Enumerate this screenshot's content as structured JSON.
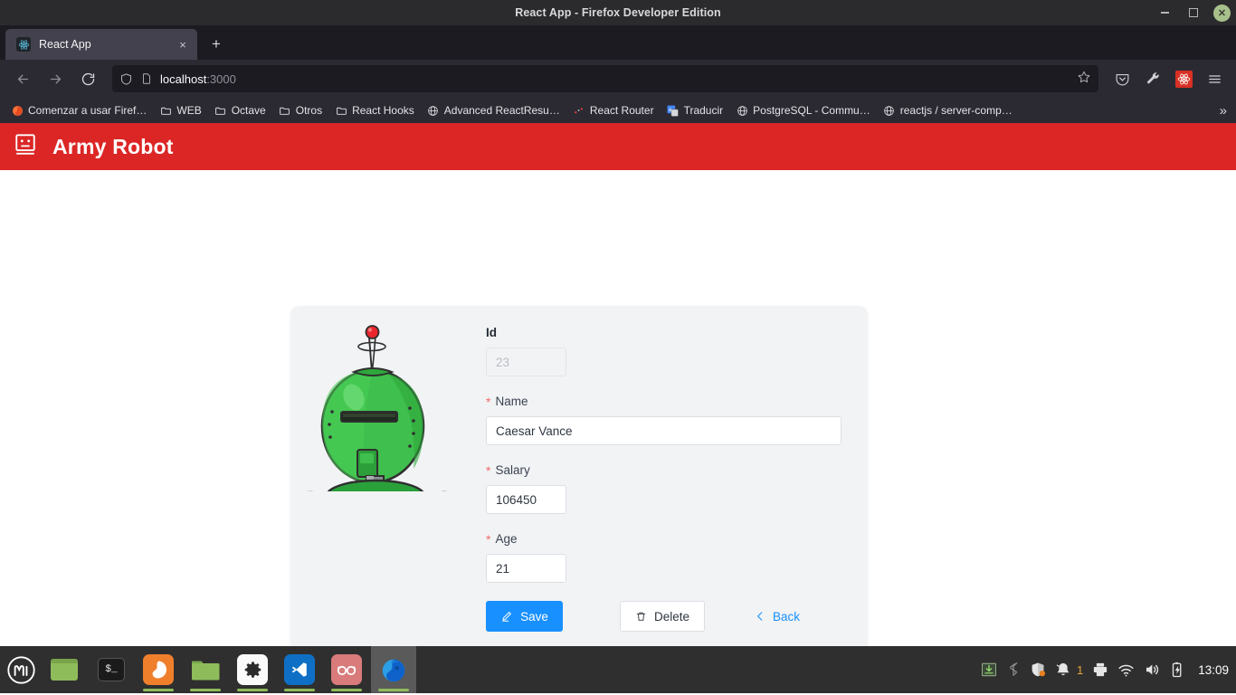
{
  "window": {
    "title": "React App - Firefox Developer Edition",
    "controls": {
      "minimize": "minimize-icon",
      "maximize": "maximize-icon",
      "close": "close-icon"
    }
  },
  "browser": {
    "tab": {
      "title": "React App",
      "favicon": "react-icon",
      "close_label": "×"
    },
    "new_tab_label": "+",
    "nav": {
      "back": "back-arrow-icon",
      "forward": "forward-arrow-icon",
      "reload": "reload-icon"
    },
    "url": {
      "host": "localhost",
      "port": ":3000",
      "shield_icon": "shield-icon",
      "page_icon": "page-icon",
      "bookmark_star": "star-icon"
    },
    "toolbar_icons": [
      "pocket-icon",
      "wrench-icon",
      "react-devtools-icon",
      "hamburger-menu-icon"
    ],
    "bookmarks": [
      {
        "label": "Comenzar a usar Firef…",
        "icon": "firefox-icon"
      },
      {
        "label": "WEB",
        "icon": "folder-icon"
      },
      {
        "label": "Octave",
        "icon": "folder-icon"
      },
      {
        "label": "Otros",
        "icon": "folder-icon"
      },
      {
        "label": "React Hooks",
        "icon": "folder-icon"
      },
      {
        "label": "Advanced ReactResu…",
        "icon": "globe-icon"
      },
      {
        "label": "React Router",
        "icon": "react-router-icon"
      },
      {
        "label": "Traducir",
        "icon": "translate-icon"
      },
      {
        "label": "PostgreSQL - Commu…",
        "icon": "globe-icon"
      },
      {
        "label": "reactjs / server-comp…",
        "icon": "globe-icon"
      }
    ],
    "bookmarks_overflow": "»"
  },
  "app": {
    "header": {
      "title": "Army Robot",
      "logo_icon": "robot-face-icon",
      "bg_color": "#dc2626"
    },
    "illustration": "green-robot-illustration",
    "form": {
      "fields": [
        {
          "name": "id",
          "label": "Id",
          "value": "23",
          "required": false,
          "disabled": true
        },
        {
          "name": "name",
          "label": "Name",
          "value": "Caesar Vance",
          "required": true,
          "disabled": false
        },
        {
          "name": "salary",
          "label": "Salary",
          "value": "106450",
          "required": true,
          "disabled": false
        },
        {
          "name": "age",
          "label": "Age",
          "value": "21",
          "required": true,
          "disabled": false
        }
      ],
      "required_marker": "*",
      "buttons": {
        "save": {
          "label": "Save",
          "icon": "edit-pencil-icon",
          "color": "#1890ff"
        },
        "delete": {
          "label": "Delete",
          "icon": "trash-icon"
        },
        "back": {
          "label": "Back",
          "icon": "chevron-left-icon",
          "color": "#1890ff"
        }
      }
    }
  },
  "taskbar": {
    "menu_icon": "linux-mint-menu-icon",
    "apps": [
      {
        "name": "show-desktop",
        "icon": "window-icon"
      },
      {
        "name": "terminal",
        "icon": "terminal-icon"
      },
      {
        "name": "firefox",
        "icon": "firefox-icon"
      },
      {
        "name": "files",
        "icon": "folder-icon"
      },
      {
        "name": "settings",
        "icon": "gear-icon"
      },
      {
        "name": "vscode",
        "icon": "vscode-icon"
      },
      {
        "name": "redshift",
        "icon": "glasses-icon"
      },
      {
        "name": "firefox-developer",
        "icon": "firefox-dev-icon"
      }
    ],
    "tray": [
      {
        "name": "download",
        "icon": "download-icon"
      },
      {
        "name": "bluetooth",
        "icon": "bluetooth-icon"
      },
      {
        "name": "update-manager",
        "icon": "shield-icon"
      },
      {
        "name": "notifications",
        "icon": "bell-icon",
        "count": "1"
      },
      {
        "name": "printer",
        "icon": "printer-icon"
      },
      {
        "name": "network",
        "icon": "wifi-icon"
      },
      {
        "name": "volume",
        "icon": "speaker-icon"
      },
      {
        "name": "battery",
        "icon": "battery-charging-icon"
      }
    ],
    "clock": "13:09"
  }
}
